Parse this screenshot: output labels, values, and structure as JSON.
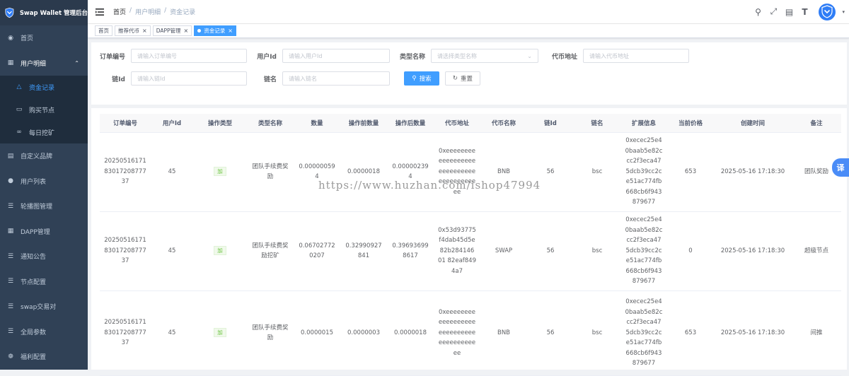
{
  "app": {
    "title": "Swap Wallet 管理后台"
  },
  "sidebar": {
    "items": [
      {
        "label": "首页",
        "icon": "dashboard-icon"
      },
      {
        "label": "用户明细",
        "icon": "table-icon",
        "expanded": true
      },
      {
        "label": "自定义品牌",
        "icon": "document-icon"
      },
      {
        "label": "用户列表",
        "icon": "user-icon"
      },
      {
        "label": "轮播图管理",
        "icon": "list-icon"
      },
      {
        "label": "DAPP管理",
        "icon": "grid-icon"
      },
      {
        "label": "通知公告",
        "icon": "list-icon"
      },
      {
        "label": "节点配置",
        "icon": "list-icon"
      },
      {
        "label": "swap交易对",
        "icon": "list-icon"
      },
      {
        "label": "全局参数",
        "icon": "list-icon"
      },
      {
        "label": "福利配置",
        "icon": "gift-icon"
      }
    ],
    "submenu": [
      {
        "label": "资金记录",
        "icon": "money-icon",
        "active": true
      },
      {
        "label": "购买节点",
        "icon": "monitor-icon"
      },
      {
        "label": "每日挖矿",
        "icon": "infinity-icon"
      }
    ]
  },
  "breadcrumb": [
    "首页",
    "用户明细",
    "资金记录"
  ],
  "tags": [
    {
      "label": "首页",
      "closable": false,
      "active": false
    },
    {
      "label": "推荐代币",
      "closable": true,
      "active": false
    },
    {
      "label": "DAPP管理",
      "closable": true,
      "active": false
    },
    {
      "label": "资金记录",
      "closable": true,
      "active": true
    }
  ],
  "search": {
    "order_no": {
      "label": "订单编号",
      "placeholder": "请输入订单编号"
    },
    "user_id": {
      "label": "用户Id",
      "placeholder": "请输入用户Id"
    },
    "type_name": {
      "label": "类型名称",
      "placeholder": "请选择类型名称"
    },
    "token_address": {
      "label": "代币地址",
      "placeholder": "请输入代币地址"
    },
    "chain_id": {
      "label": "链Id",
      "placeholder": "请输入链Id"
    },
    "chain_name": {
      "label": "链名",
      "placeholder": "请输入链名"
    },
    "search_button": "搜索",
    "reset_button": "重置"
  },
  "table": {
    "columns": [
      "订单编号",
      "用户Id",
      "操作类型",
      "类型名称",
      "数量",
      "操作前数量",
      "操作后数量",
      "代币地址",
      "代币名称",
      "链Id",
      "链名",
      "扩展信息",
      "当前价格",
      "创建时间",
      "备注"
    ],
    "rows": [
      [
        "2025051617183017208777 37",
        "45",
        "加",
        "团队手续费奖励",
        "0.000000594",
        "0.0000018",
        "0.000002394",
        "0xeeeeeeeeeeeeeeeeeeeeeeeeeeeeeeeeeeeeeeee",
        "BNB",
        "56",
        "bsc",
        "0xecec25e40baab5e82ccc2f3eca475dcb39cc2ce51ac774fb668cb6f943879677",
        "653",
        "2025-05-16 17:18:30",
        "团队奖励"
      ],
      [
        "2025051617183017208777 37",
        "45",
        "加",
        "团队手续费奖励挖矿",
        "0.067027720207",
        "0.32990927841",
        "0.396936998617",
        "0x53d93775f4dab45d5e82b28414601 82eaf8494a7",
        "SWAP",
        "56",
        "bsc",
        "0xecec25e40baab5e82ccc2f3eca475dcb39cc2ce51ac774fb668cb6f943879677",
        "0",
        "2025-05-16 17:18:30",
        "超级节点"
      ],
      [
        "2025051617183017208777 37",
        "45",
        "加",
        "团队手续费奖励",
        "0.0000015",
        "0.0000003",
        "0.0000018",
        "0xeeeeeeeeeeeeeeeeeeeeeeeeeeeeeeeeeeeeeeee",
        "BNB",
        "56",
        "bsc",
        "0xecec25e40baab5e82ccc2f3eca475dcb39cc2ce51ac774fb668cb6f943879677",
        "653",
        "2025-05-16 17:18:30",
        "间推"
      ]
    ]
  },
  "widgets": {
    "translate_label": "译"
  },
  "watermark": "https://www.huzhan.com/ishop47994",
  "colors": {
    "sidebar_bg": "#304156",
    "primary": "#409eff",
    "success": "#67c23a"
  }
}
